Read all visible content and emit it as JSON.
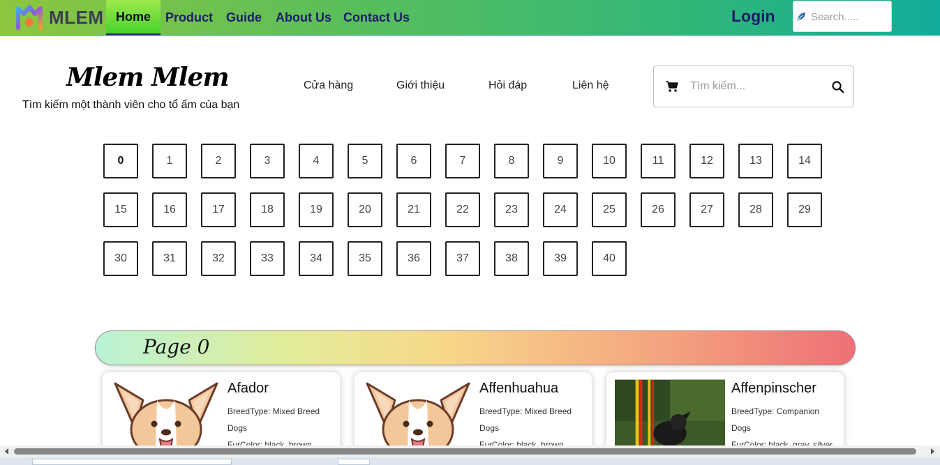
{
  "topnav": {
    "brand": "MLEM",
    "links": [
      {
        "label": "Home",
        "active": true
      },
      {
        "label": "Product",
        "active": false
      },
      {
        "label": "Guide",
        "active": false
      },
      {
        "label": "About Us",
        "active": false
      },
      {
        "label": "Contact Us",
        "active": false
      }
    ],
    "login": "Login",
    "search_placeholder": "Search....."
  },
  "header": {
    "title": "Mlem Mlem",
    "tagline": "Tìm kiếm một thành viên cho tổ ấm của bạn",
    "menu": [
      "Cửa hàng",
      "Giới thiệu",
      "Hỏi đáp",
      "Liên hệ"
    ],
    "search_placeholder": "Tìm kiếm..."
  },
  "pagination": {
    "pages": [
      "0",
      "1",
      "2",
      "3",
      "4",
      "5",
      "6",
      "7",
      "8",
      "9",
      "10",
      "11",
      "12",
      "13",
      "14",
      "15",
      "16",
      "17",
      "18",
      "19",
      "20",
      "21",
      "22",
      "23",
      "24",
      "25",
      "26",
      "27",
      "28",
      "29",
      "30",
      "31",
      "32",
      "33",
      "34",
      "35",
      "36",
      "37",
      "38",
      "39",
      "40"
    ],
    "current": "0"
  },
  "banner": {
    "title": "Page 0"
  },
  "cards": [
    {
      "name": "Afador",
      "breed_line1": "BreedType: Mixed Breed",
      "breed_line2": "Dogs",
      "fur": "FurColor: black, brown, gray",
      "image": "corgi-cartoon"
    },
    {
      "name": "Affenhuahua",
      "breed_line1": "BreedType: Mixed Breed",
      "breed_line2": "Dogs",
      "fur": "FurColor: black, brown",
      "image": "corgi-cartoon"
    },
    {
      "name": "Affenpinscher",
      "breed_line1": "BreedType: Companion",
      "breed_line2": "Dogs",
      "fur": "FurColor: black, gray, silver",
      "image": "dog-photo"
    }
  ],
  "colors": {
    "nav_text": "#1e1b6b",
    "nav_gradient_start": "#8dc63f",
    "nav_gradient_end": "#12ac9a"
  }
}
